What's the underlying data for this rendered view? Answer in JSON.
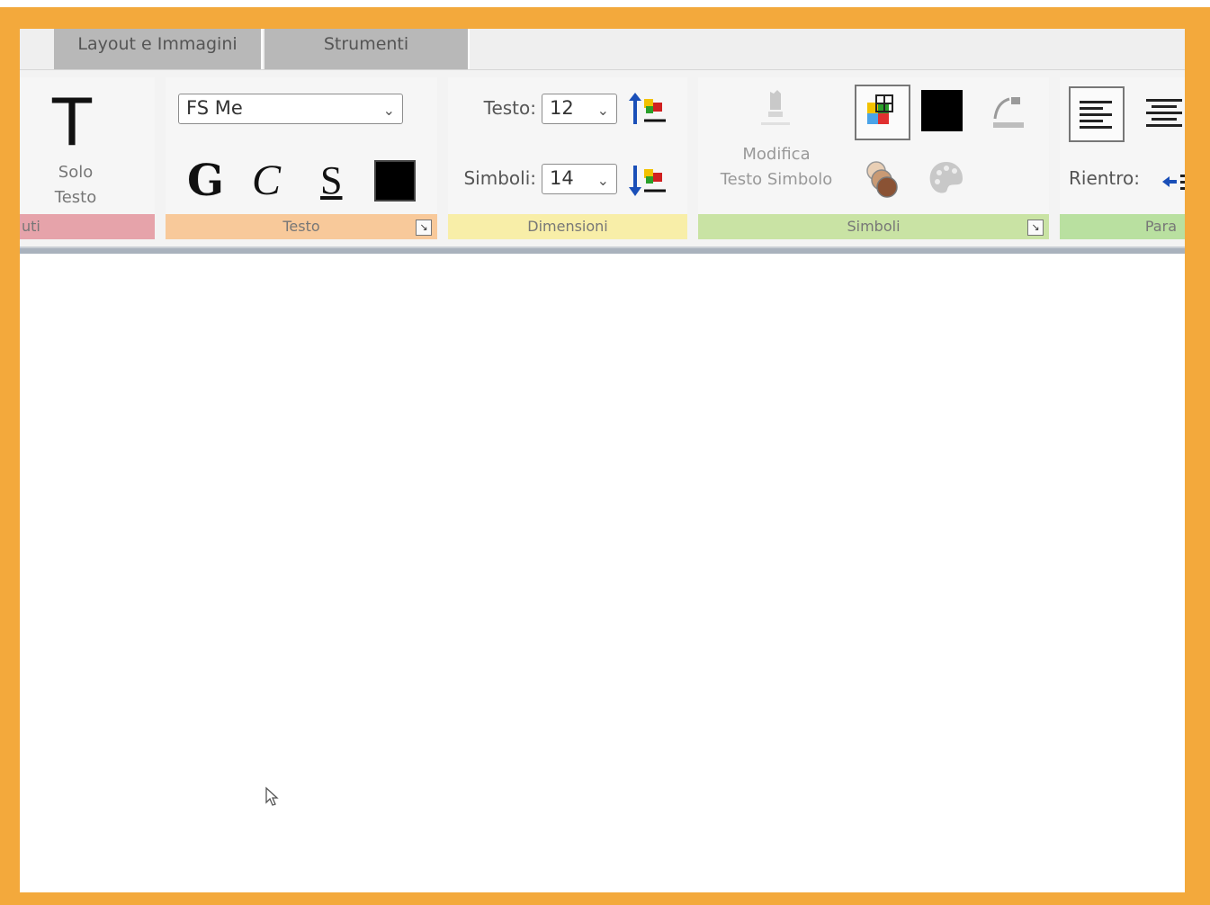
{
  "tabs": [
    {
      "label": "Layout e Immagini"
    },
    {
      "label": "Strumenti"
    }
  ],
  "groups": {
    "solo": {
      "line1": "Solo",
      "line2": "Testo",
      "footer": "uti",
      "footer_color": "#e6a3aa"
    },
    "testo": {
      "font_value": "FS Me",
      "bold_glyph": "G",
      "italic_glyph": "C",
      "underline_glyph": "S",
      "footer": "Testo",
      "footer_color": "#f8c99a"
    },
    "dimensioni": {
      "testo_label": "Testo:",
      "testo_value": "12",
      "simboli_label": "Simboli:",
      "simboli_value": "14",
      "footer": "Dimensioni",
      "footer_color": "#f8eea8"
    },
    "simboli": {
      "modifica_line1": "Modifica",
      "modifica_line2": "Testo Simbolo",
      "footer": "Simboli",
      "footer_color": "#c9e3a4"
    },
    "paragrafo": {
      "rientro_label": "Rientro:",
      "footer": "Para",
      "footer_color": "#b9e0a0"
    }
  },
  "icons": {
    "dropdown": "chevron-down",
    "launcher": "↘"
  },
  "colors": {
    "frame": "#f3a93c",
    "tab_bg": "#b8b8b8"
  }
}
